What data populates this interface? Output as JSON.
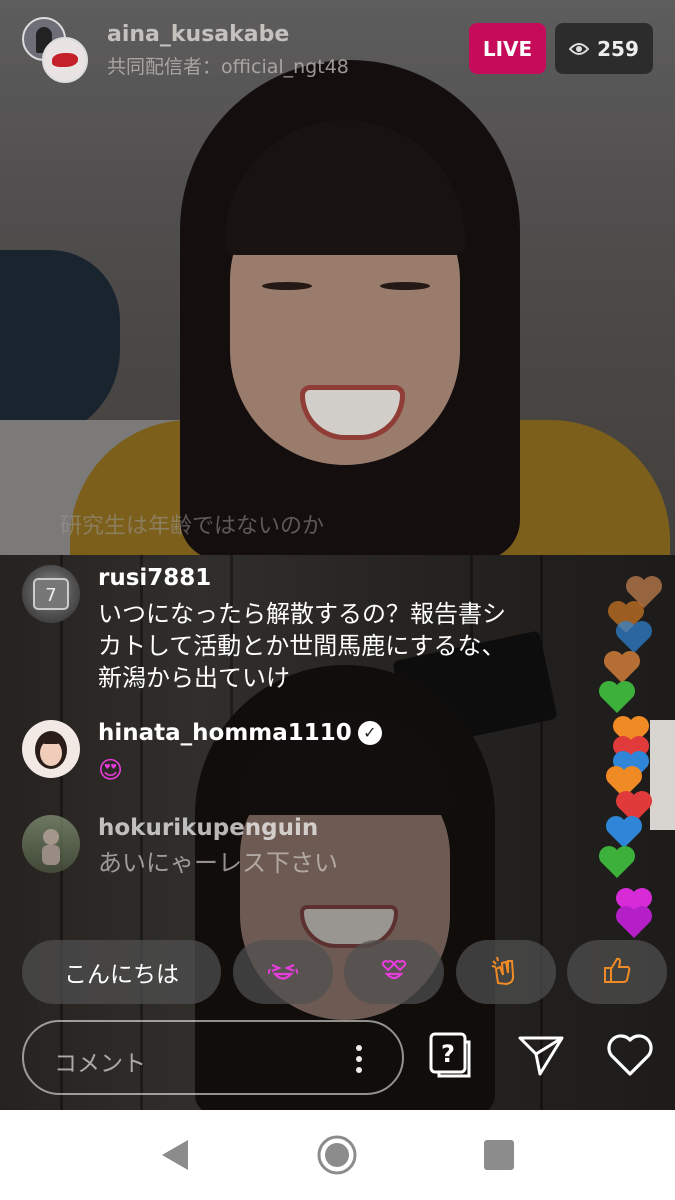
{
  "header": {
    "username": "aina_kusakabe",
    "cohost": "共同配信者：official_ngt48",
    "live_label": "LIVE",
    "viewer_count": "259",
    "viewer_icon": "eye-icon"
  },
  "overlay_comment": "研究生は年齢ではないのか",
  "comments": [
    {
      "user": "rusi7881",
      "text_lines": [
        "いつになったら解散するの？報告書シ",
        "カトして活動とか世間馬鹿にするな、",
        "新潟から出ていけ"
      ]
    },
    {
      "user": "hinata_homma1110",
      "verified": true,
      "text": "😍"
    },
    {
      "user": "hokurikupenguin",
      "text": "あいにゃーレス下さい"
    }
  ],
  "quick_replies": {
    "text": "こんにちは",
    "emoji": [
      "😂",
      "😍",
      "👏",
      "👍"
    ]
  },
  "composer": {
    "placeholder": "コメント"
  },
  "icons": {
    "question": "question-box-icon",
    "send": "send-icon",
    "like": "heart-icon"
  },
  "colors": {
    "live_badge": "#c60b5a",
    "emoji_pink": "#e83cdc",
    "emoji_orange": "#f08a24"
  }
}
